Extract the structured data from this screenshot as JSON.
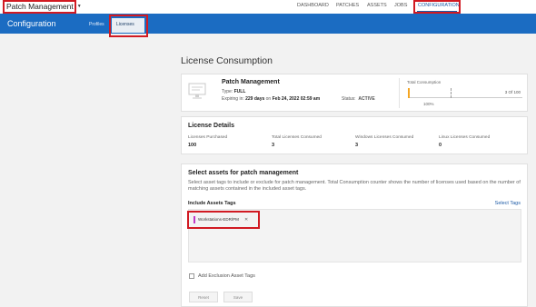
{
  "app": {
    "selector_label": "Patch Management"
  },
  "topnav": {
    "items": [
      "DASHBOARD",
      "PATCHES",
      "ASSETS",
      "JOBS",
      "CONFIGURATION"
    ]
  },
  "header": {
    "title": "Configuration",
    "tabs": [
      "Profiles",
      "Licenses"
    ]
  },
  "page": {
    "title": "License Consumption"
  },
  "product": {
    "title": "Patch Management",
    "type_label": "Type:",
    "type_value": "FULL",
    "expiring_prefix": "Expiring in:",
    "expiring_days": "229 days",
    "expiring_on": "on",
    "expiring_date": "Feb 24, 2022 02:59 am",
    "status_label": "Status:",
    "status_value": "ACTIVE",
    "consumption_label": "Total Consumption",
    "consumption_count": "3 Of 100",
    "consumption_pct_label": "100%",
    "consumption_fraction": 0.03
  },
  "license_details": {
    "title": "License Details",
    "columns": [
      {
        "label": "Licenses Purchased",
        "value": "100"
      },
      {
        "label": "Total Licenses Consumed",
        "value": "3"
      },
      {
        "label": "Windows Licenses Consumed",
        "value": "3"
      },
      {
        "label": "Linux Licenses Consumed",
        "value": "0"
      }
    ]
  },
  "select_assets": {
    "title": "Select assets for patch management",
    "description": "Select asset tags to include or exclude for patch management. Total Consumption counter shows the number of licenses used based on the number of matching assets contained in the included asset tags.",
    "include_label": "Include Assets Tags",
    "select_tags_link": "Select Tags",
    "tags": [
      {
        "label": "Workstations-EDR/PM",
        "color": "#c039c7"
      }
    ],
    "exclusion_label": "Add Exclusion Asset Tags",
    "reset_label": "Reset",
    "save_label": "Save"
  },
  "colors": {
    "brand_blue": "#1b6cc2",
    "highlight_red": "#d11a22",
    "tag_purple": "#c039c7",
    "gauge_orange": "#f5a623"
  }
}
